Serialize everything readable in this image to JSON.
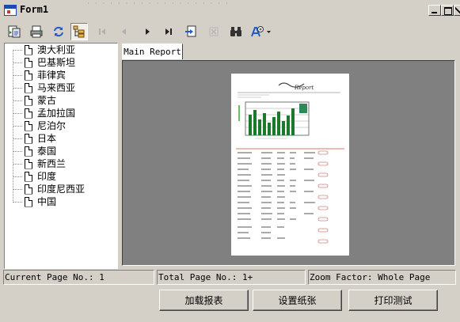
{
  "window": {
    "title": "Form1",
    "ghost_text": "· · · · · ·  · · · · · ·  · · · · · · ·"
  },
  "toolbar": {
    "buttons": [
      {
        "name": "export-icon"
      },
      {
        "name": "print-icon"
      },
      {
        "name": "refresh-icon"
      },
      {
        "name": "toggle-tree-icon"
      },
      {
        "name": "first-page-icon"
      },
      {
        "name": "previous-page-icon"
      },
      {
        "name": "next-page-icon"
      },
      {
        "name": "last-page-icon"
      },
      {
        "name": "goto-page-icon"
      },
      {
        "name": "stop-icon"
      },
      {
        "name": "search-icon"
      },
      {
        "name": "zoom-icon"
      }
    ]
  },
  "tree": {
    "items": [
      "澳大利亚",
      "巴基斯坦",
      "菲律宾",
      "马来西亚",
      "蒙古",
      "孟加拉国",
      "尼泊尔",
      "日本",
      "泰国",
      "新西兰",
      "印度",
      "印度尼西亚",
      "中国"
    ]
  },
  "report": {
    "tab_label": "Main Report"
  },
  "status": {
    "current_page": "Current Page No.: 1",
    "total_page": "Total Page No.: 1+",
    "zoom": "Zoom Factor: Whole Page"
  },
  "buttons": {
    "load_report": "加载报表",
    "page_setup": "设置纸张",
    "print_test": "打印测试"
  }
}
